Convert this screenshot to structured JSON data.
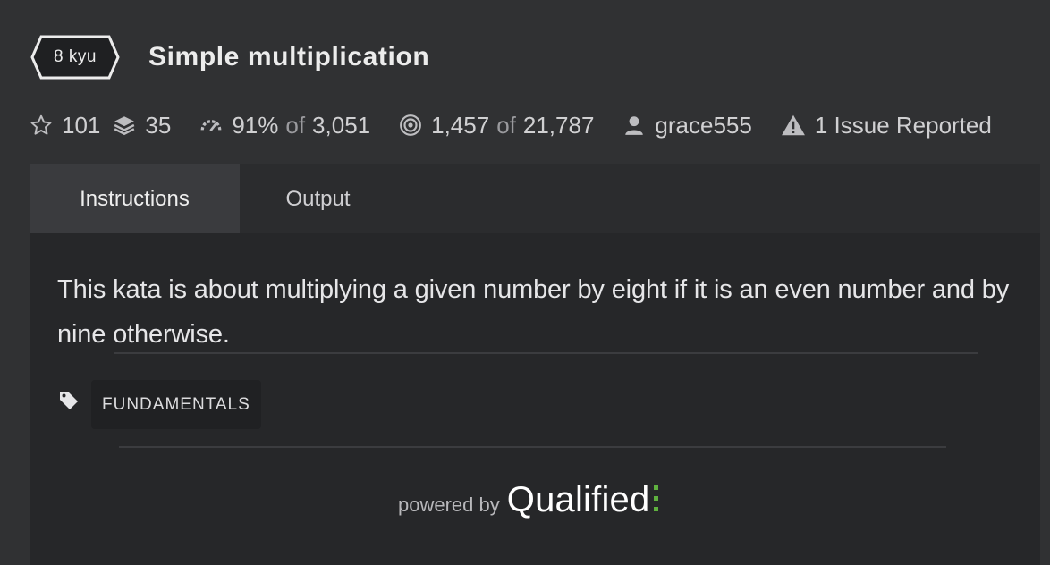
{
  "kata": {
    "rank": "8 kyu",
    "title": "Simple multiplication"
  },
  "stats": {
    "stars": "101",
    "collections": "35",
    "satisfaction": "91%",
    "satisfaction_of": "of",
    "satisfaction_votes": "3,051",
    "completed": "1,457",
    "completed_of": "of",
    "attempts": "21,787",
    "author": "grace555",
    "issues": "1 Issue Reported"
  },
  "tabs": [
    "Instructions",
    "Output"
  ],
  "description": "This kata is about multiplying a given number by eight if it is an even number and by nine otherwise.",
  "tags": [
    "FUNDAMENTALS"
  ],
  "footer": {
    "powered_by": "powered by",
    "brand": "Qualified"
  },
  "colors": {
    "background": "#303133",
    "panel": "#262729",
    "active_tab": "#3a3b3e",
    "qualified_accent": "#5fb13f"
  },
  "icons": [
    "star-icon",
    "stack-icon",
    "gauge-icon",
    "target-icon",
    "user-icon",
    "warning-icon",
    "tag-icon"
  ]
}
